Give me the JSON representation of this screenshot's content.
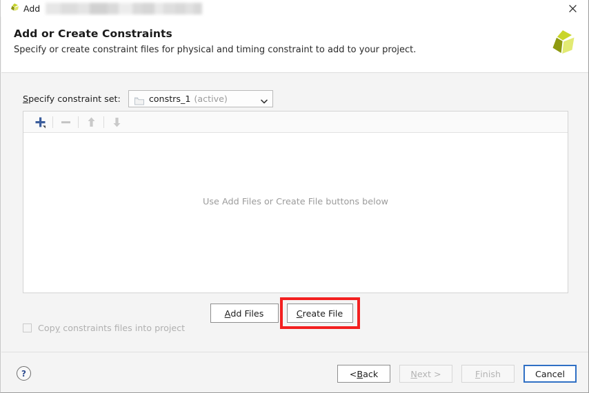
{
  "window": {
    "title": "Add",
    "redacted_title_present": true,
    "close_icon": "close-icon",
    "app_logo_icon": "vivado-logo-icon"
  },
  "header": {
    "title": "Add or Create Constraints",
    "subtitle": "Specify or create constraint files for physical and timing constraint to add to your project.",
    "logo_icon": "xilinx-logo-icon"
  },
  "constraint_set": {
    "label_prefix": "S",
    "label_rest": "pecify constraint set:",
    "folder_icon": "folder-icon",
    "value": "constrs_1",
    "state": "(active)",
    "caret_icon": "chevron-down-icon"
  },
  "toolbar": {
    "add_icon": "plus-icon",
    "remove_icon": "minus-icon",
    "move_up_icon": "arrow-up-icon",
    "move_down_icon": "arrow-down-icon"
  },
  "file_list": {
    "empty_message": "Use Add Files or Create File buttons below",
    "items": []
  },
  "actions": {
    "add_files": {
      "accel": "A",
      "rest": "dd Files"
    },
    "create_file": {
      "accel": "C",
      "rest": "reate File",
      "highlighted": true,
      "highlight_color": "#f32020"
    }
  },
  "copy_option": {
    "label_pre": "Cop",
    "accel": "y",
    "label_post": " constraints files into project",
    "checked": false,
    "enabled": false
  },
  "footer": {
    "help_icon": "help-icon",
    "help_label": "?",
    "buttons": [
      {
        "name": "back",
        "pre": "< ",
        "accel": "B",
        "post": "ack",
        "enabled": true,
        "focused": false
      },
      {
        "name": "next",
        "pre": "",
        "accel": "N",
        "post": "ext >",
        "enabled": false,
        "focused": false
      },
      {
        "name": "finish",
        "pre": "",
        "accel": "F",
        "post": "inish",
        "enabled": false,
        "focused": false
      },
      {
        "name": "cancel",
        "pre": "",
        "accel": "",
        "post": "Cancel",
        "enabled": true,
        "focused": true
      }
    ]
  },
  "colors": {
    "accent_blue": "#2f6fc4",
    "plus_blue": "#3b5d9c",
    "highlight_red": "#f32020",
    "logo_green": "#c5d22a",
    "panel_bg": "#ffffff",
    "body_bg": "#f4f4f4"
  }
}
